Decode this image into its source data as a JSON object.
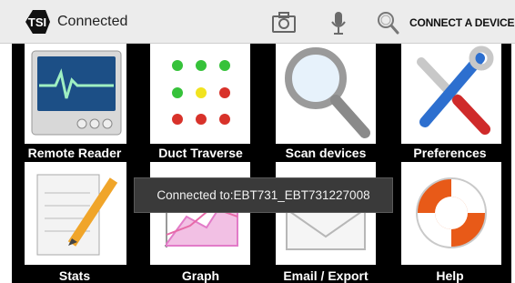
{
  "header": {
    "status": "Connected",
    "connect_label": "CONNECT A DEVICE",
    "icons": [
      "tsi-logo",
      "camera-icon",
      "microphone-icon",
      "search-icon"
    ]
  },
  "tiles": [
    {
      "label": "Remote Reader",
      "icon": "monitor-icon"
    },
    {
      "label": "Duct Traverse",
      "icon": "dot-grid-icon"
    },
    {
      "label": "Scan devices",
      "icon": "magnifier-icon"
    },
    {
      "label": "Preferences",
      "icon": "tools-icon"
    },
    {
      "label": "Stats",
      "icon": "notepad-pencil-icon"
    },
    {
      "label": "Graph",
      "icon": "graph-icon"
    },
    {
      "label": "Email / Export",
      "icon": "envelope-icon"
    },
    {
      "label": "Help",
      "icon": "lifebuoy-icon"
    }
  ],
  "toast": {
    "text": "Connected to:EBT731_EBT731227008"
  },
  "colors": {
    "accent_red": "#d8322a",
    "accent_green": "#36c23a",
    "accent_yellow": "#f1e31f",
    "topbar": "#ececec"
  }
}
